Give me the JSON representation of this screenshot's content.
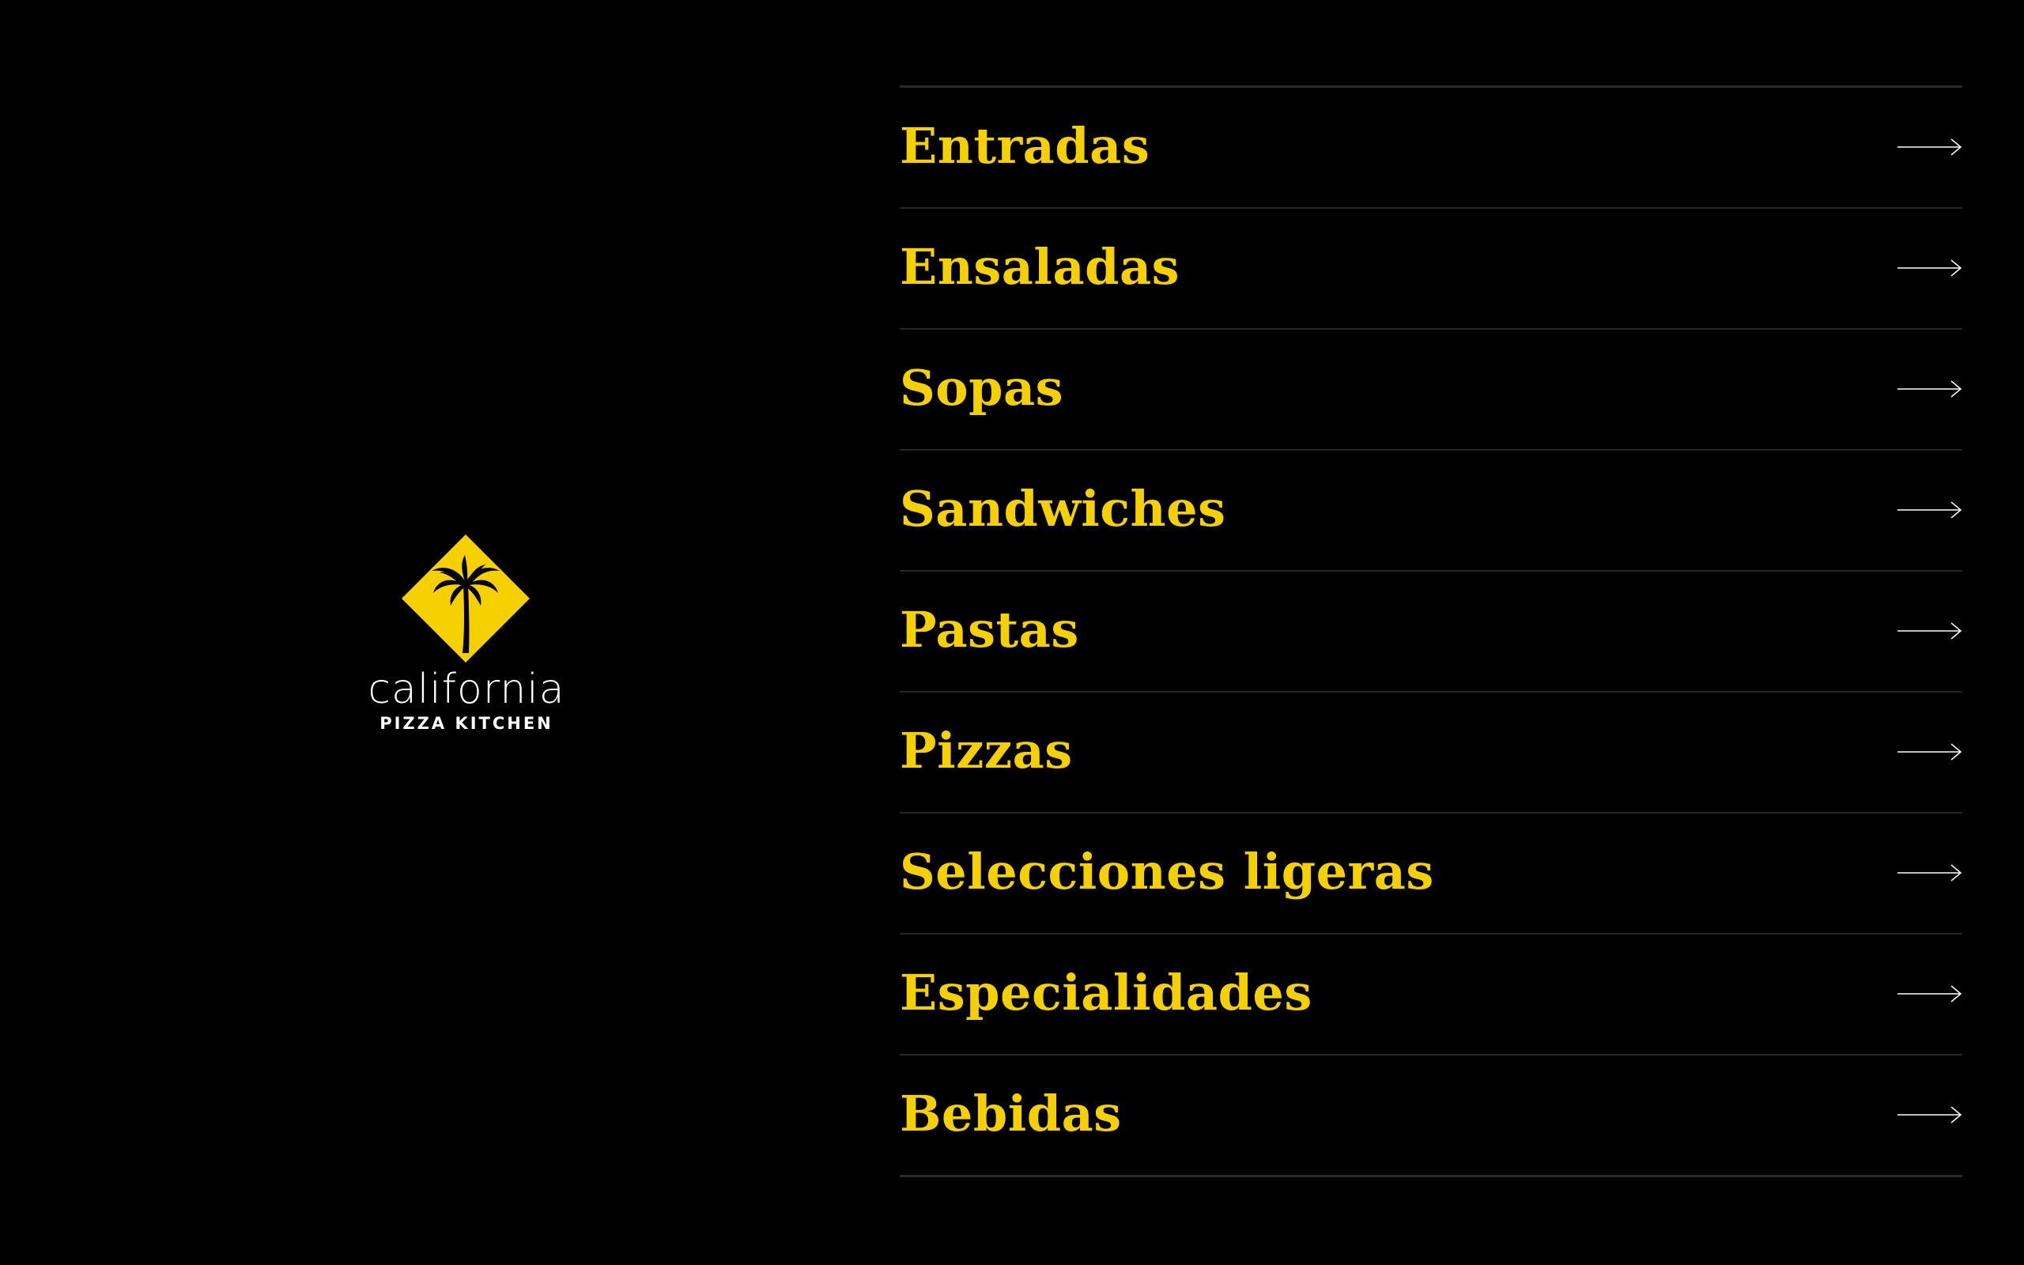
{
  "brand": {
    "wordmark": "california",
    "subtitle": "PIZZA KITCHEN",
    "logo_icon": "palm-tree-diamond-icon",
    "logo_color": "#f5d000"
  },
  "menu": {
    "items": [
      {
        "label": "Entradas",
        "icon": "arrow-right-icon"
      },
      {
        "label": "Ensaladas",
        "icon": "arrow-right-icon"
      },
      {
        "label": "Sopas",
        "icon": "arrow-right-icon"
      },
      {
        "label": "Sandwiches",
        "icon": "arrow-right-icon"
      },
      {
        "label": "Pastas",
        "icon": "arrow-right-icon"
      },
      {
        "label": "Pizzas",
        "icon": "arrow-right-icon"
      },
      {
        "label": "Selecciones ligeras",
        "icon": "arrow-right-icon"
      },
      {
        "label": "Especialidades",
        "icon": "arrow-right-icon"
      },
      {
        "label": "Bebidas",
        "icon": "arrow-right-icon"
      }
    ]
  },
  "colors": {
    "background": "#000000",
    "accent": "#f5d000",
    "divider": "#262626",
    "arrow": "#ffffff"
  }
}
